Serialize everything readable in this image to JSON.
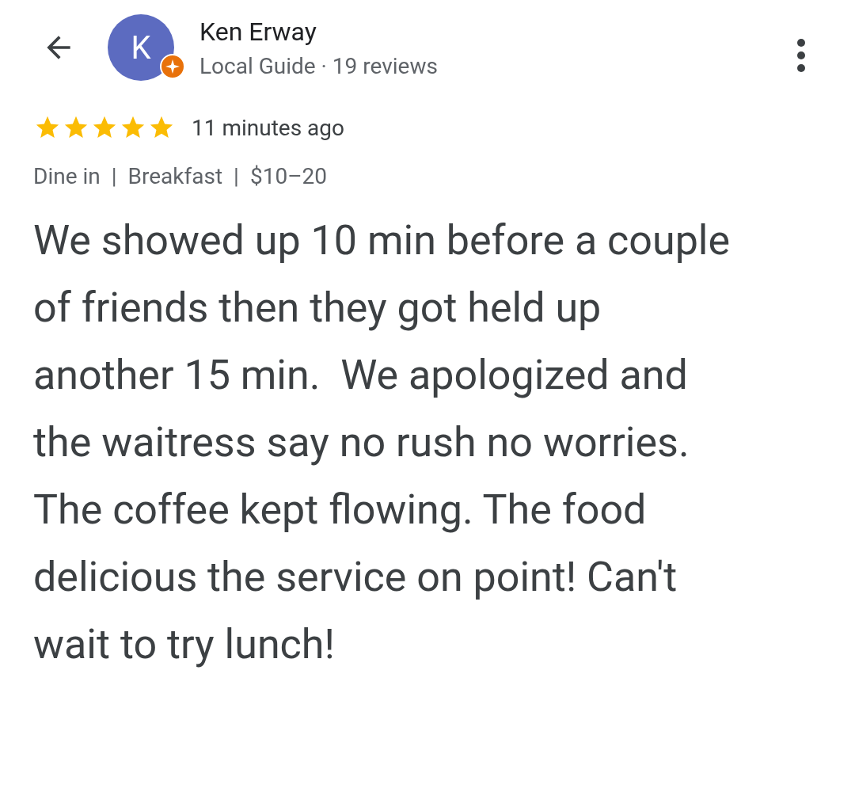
{
  "reviewer": {
    "avatar_letter": "K",
    "name": "Ken Erway",
    "subtitle": "Local Guide · 19 reviews"
  },
  "review": {
    "stars": 5,
    "time": "11 minutes ago",
    "tags": [
      "Dine in",
      "Breakfast",
      "$10–20"
    ],
    "tag_separator": "|",
    "text": "We showed up 10 min before a couple of friends then they got held up another 15 min.  We apologized and the waitress say no rush no worries. The coffee kept flowing. The food delicious the service on point! Can't wait to try lunch!"
  }
}
